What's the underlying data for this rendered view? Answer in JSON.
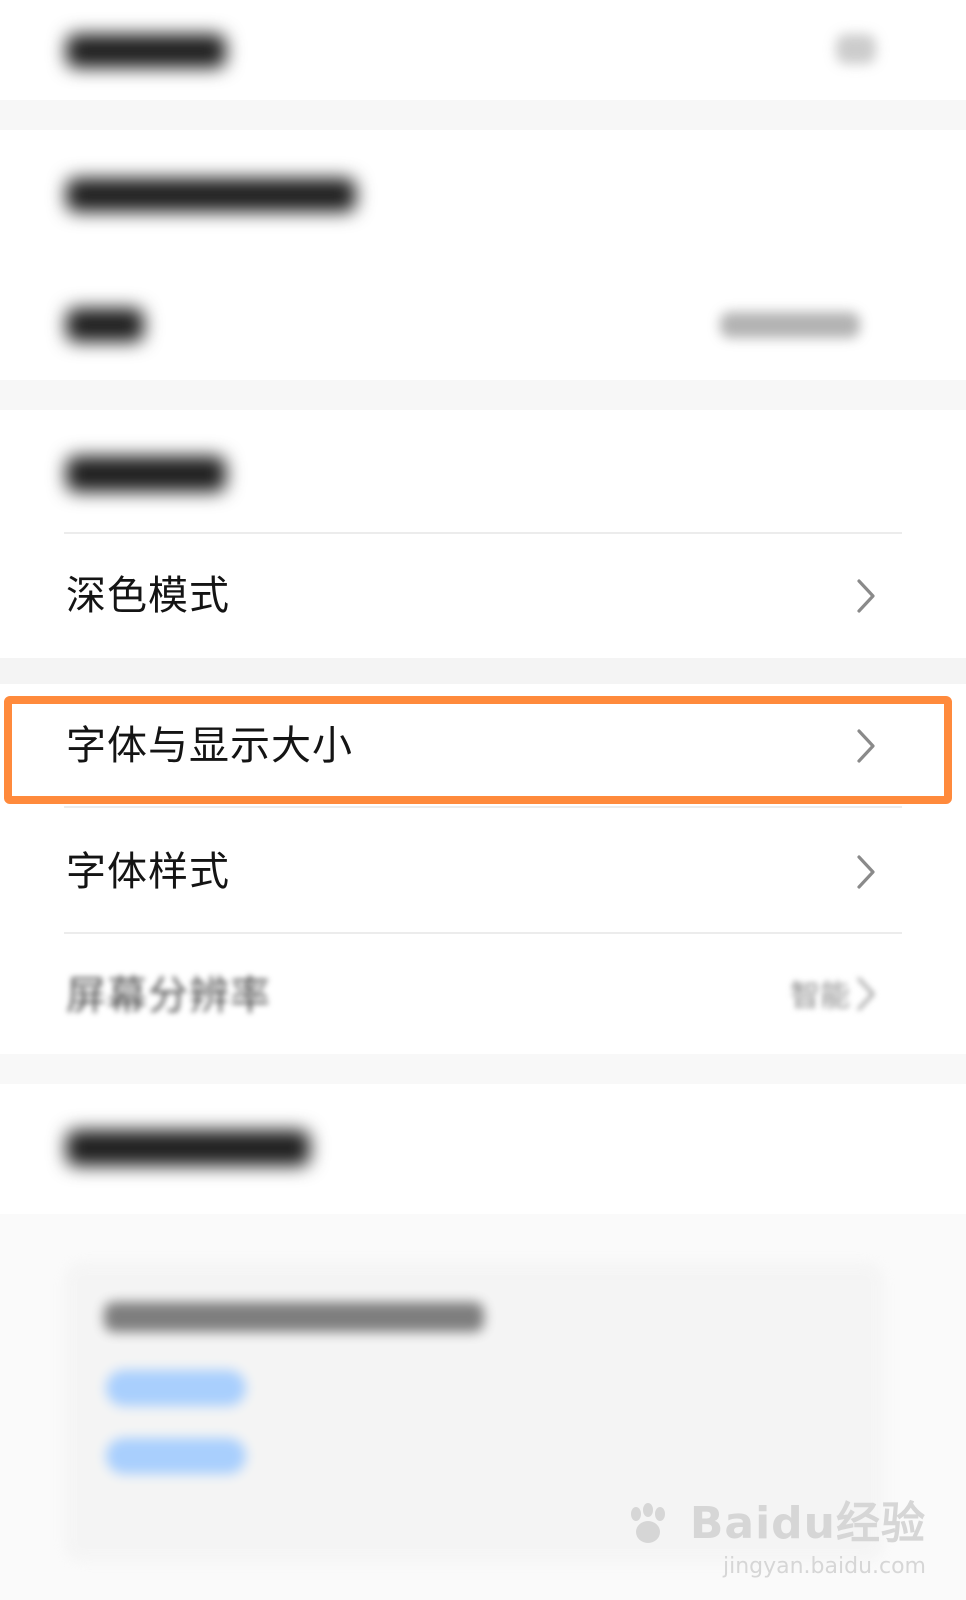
{
  "settings": {
    "items": [
      {
        "label": "深色模式"
      },
      {
        "label": "字体与显示大小"
      },
      {
        "label": "字体样式"
      },
      {
        "label": "屏幕分辨率",
        "value": "智能"
      }
    ]
  },
  "watermark": {
    "brand": "Baidu经验",
    "url": "jingyan.baidu.com"
  },
  "colors": {
    "highlight": "#ff8a3c",
    "link_blue": "#8ec1ff"
  }
}
